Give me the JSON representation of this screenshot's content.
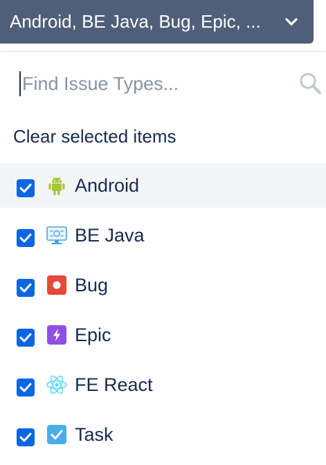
{
  "trigger": {
    "label": "Android, BE Java, Bug, Epic, ...",
    "icon": "chevron-down-icon"
  },
  "search": {
    "placeholder": "Find Issue Types...",
    "value": "",
    "icon": "search-icon"
  },
  "clear_label": "Clear selected items",
  "items": [
    {
      "label": "Android",
      "checked": true,
      "icon": "android-icon",
      "color": "#a4c639"
    },
    {
      "label": "BE Java",
      "checked": true,
      "icon": "monitor-icon",
      "color": "#4ba3d9"
    },
    {
      "label": "Bug",
      "checked": true,
      "icon": "bug-icon",
      "color": "#e5493a"
    },
    {
      "label": "Epic",
      "checked": true,
      "icon": "epic-icon",
      "color": "#904ee2"
    },
    {
      "label": "FE React",
      "checked": true,
      "icon": "react-icon",
      "color": "#61dafb"
    },
    {
      "label": "Task",
      "checked": true,
      "icon": "task-icon",
      "color": "#4bade8"
    }
  ],
  "colors": {
    "trigger_bg": "#505f79",
    "checkbox": "#0c66e4",
    "highlight": "#f4f5f7"
  }
}
